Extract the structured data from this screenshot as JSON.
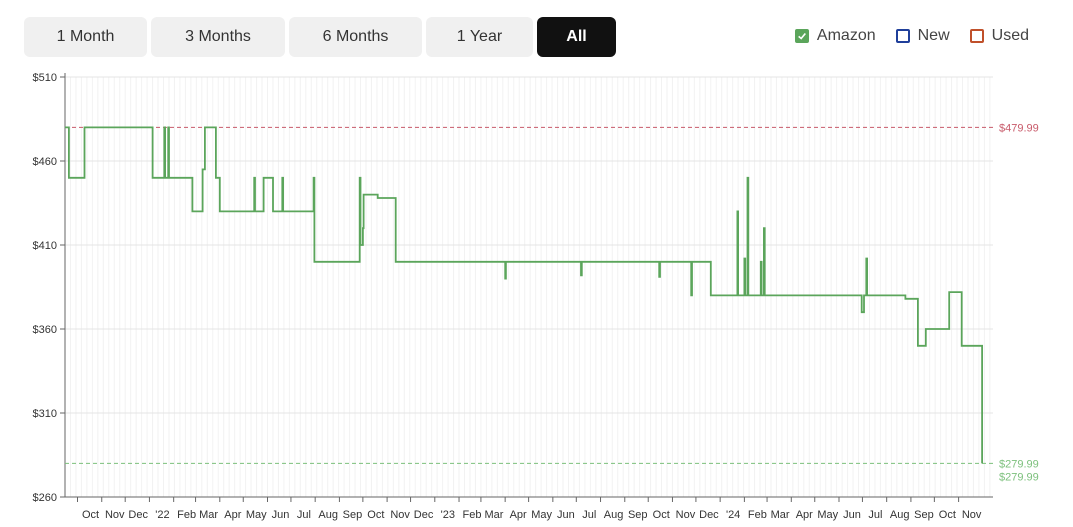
{
  "ranges": [
    {
      "label": "1 Month",
      "active": false
    },
    {
      "label": "3 Months",
      "active": false
    },
    {
      "label": "6 Months",
      "active": false
    },
    {
      "label": "1 Year",
      "active": false
    },
    {
      "label": "All",
      "active": true
    }
  ],
  "legend": [
    {
      "label": "Amazon",
      "color": "#5ba55b",
      "checked": true
    },
    {
      "label": "New",
      "color": "#1f3f9a",
      "checked": false
    },
    {
      "label": "Used",
      "color": "#c0502a",
      "checked": false
    }
  ],
  "chart_data": {
    "type": "line",
    "x_axis": "dates",
    "ylim": [
      260,
      510
    ],
    "y_ticks": [
      {
        "value": 510,
        "label": "$510"
      },
      {
        "value": 460,
        "label": "$460"
      },
      {
        "value": 410,
        "label": "$410"
      },
      {
        "value": 360,
        "label": "$360"
      },
      {
        "value": 310,
        "label": "$310"
      },
      {
        "value": 260,
        "label": "$260"
      }
    ],
    "xlim": [
      "2021-09-15",
      "2024-12-15"
    ],
    "x_ticks": [
      {
        "date": "2021-10-01",
        "label": "Oct"
      },
      {
        "date": "2021-11-01",
        "label": "Nov"
      },
      {
        "date": "2021-12-01",
        "label": "Dec"
      },
      {
        "date": "2022-01-01",
        "label": "'22"
      },
      {
        "date": "2022-02-01",
        "label": "Feb"
      },
      {
        "date": "2022-03-01",
        "label": "Mar"
      },
      {
        "date": "2022-04-01",
        "label": "Apr"
      },
      {
        "date": "2022-05-01",
        "label": "May"
      },
      {
        "date": "2022-06-01",
        "label": "Jun"
      },
      {
        "date": "2022-07-01",
        "label": "Jul"
      },
      {
        "date": "2022-08-01",
        "label": "Aug"
      },
      {
        "date": "2022-09-01",
        "label": "Sep"
      },
      {
        "date": "2022-10-01",
        "label": "Oct"
      },
      {
        "date": "2022-11-01",
        "label": "Nov"
      },
      {
        "date": "2022-12-01",
        "label": "Dec"
      },
      {
        "date": "2023-01-01",
        "label": "'23"
      },
      {
        "date": "2023-02-01",
        "label": "Feb"
      },
      {
        "date": "2023-03-01",
        "label": "Mar"
      },
      {
        "date": "2023-04-01",
        "label": "Apr"
      },
      {
        "date": "2023-05-01",
        "label": "May"
      },
      {
        "date": "2023-06-01",
        "label": "Jun"
      },
      {
        "date": "2023-07-01",
        "label": "Jul"
      },
      {
        "date": "2023-08-01",
        "label": "Aug"
      },
      {
        "date": "2023-09-01",
        "label": "Sep"
      },
      {
        "date": "2023-10-01",
        "label": "Oct"
      },
      {
        "date": "2023-11-01",
        "label": "Nov"
      },
      {
        "date": "2023-12-01",
        "label": "Dec"
      },
      {
        "date": "2024-01-01",
        "label": "'24"
      },
      {
        "date": "2024-02-01",
        "label": "Feb"
      },
      {
        "date": "2024-03-01",
        "label": "Mar"
      },
      {
        "date": "2024-04-01",
        "label": "Apr"
      },
      {
        "date": "2024-05-01",
        "label": "May"
      },
      {
        "date": "2024-06-01",
        "label": "Jun"
      },
      {
        "date": "2024-07-01",
        "label": "Jul"
      },
      {
        "date": "2024-08-01",
        "label": "Aug"
      },
      {
        "date": "2024-09-01",
        "label": "Sep"
      },
      {
        "date": "2024-10-01",
        "label": "Oct"
      },
      {
        "date": "2024-11-01",
        "label": "Nov"
      }
    ],
    "reference_lines": [
      {
        "value": 479.99,
        "label": "$479.99",
        "color": "#c85a6a"
      },
      {
        "value": 279.99,
        "label": "$279.99",
        "color": "#7cc07c"
      }
    ],
    "current_price_label": "$279.99",
    "series": [
      {
        "name": "Amazon",
        "color": "#5ba55b",
        "step": true,
        "points": [
          [
            "2021-09-15",
            479.99
          ],
          [
            "2021-09-20",
            450
          ],
          [
            "2021-10-10",
            479.99
          ],
          [
            "2021-11-25",
            479.99
          ],
          [
            "2021-12-20",
            479.99
          ],
          [
            "2022-01-05",
            450
          ],
          [
            "2022-01-20",
            479.99
          ],
          [
            "2022-01-21",
            450
          ],
          [
            "2022-01-25",
            479.99
          ],
          [
            "2022-01-26",
            450
          ],
          [
            "2022-02-25",
            429.99
          ],
          [
            "2022-03-10",
            454.99
          ],
          [
            "2022-03-13",
            479.99
          ],
          [
            "2022-03-27",
            450
          ],
          [
            "2022-04-01",
            429.99
          ],
          [
            "2022-05-15",
            449.99
          ],
          [
            "2022-05-16",
            429.99
          ],
          [
            "2022-05-27",
            449.99
          ],
          [
            "2022-06-08",
            429.99
          ],
          [
            "2022-06-20",
            449.99
          ],
          [
            "2022-06-21",
            429.99
          ],
          [
            "2022-07-30",
            449.99
          ],
          [
            "2022-07-31",
            399.99
          ],
          [
            "2022-09-27",
            449.99
          ],
          [
            "2022-09-28",
            409.99
          ],
          [
            "2022-10-01",
            419.99
          ],
          [
            "2022-10-02",
            439.99
          ],
          [
            "2022-10-20",
            437.99
          ],
          [
            "2022-11-12",
            399.99
          ],
          [
            "2023-03-01",
            399.99
          ],
          [
            "2023-04-01",
            389.99
          ],
          [
            "2023-04-02",
            399.99
          ],
          [
            "2023-07-07",
            391.99
          ],
          [
            "2023-07-08",
            399.99
          ],
          [
            "2023-10-15",
            390.99
          ],
          [
            "2023-10-16",
            399.99
          ],
          [
            "2023-11-25",
            379.99
          ],
          [
            "2023-11-26",
            399.99
          ],
          [
            "2023-12-20",
            379.99
          ],
          [
            "2024-01-23",
            429.99
          ],
          [
            "2024-01-24",
            379.99
          ],
          [
            "2024-02-01",
            401.99
          ],
          [
            "2024-02-02",
            379.99
          ],
          [
            "2024-02-05",
            449.99
          ],
          [
            "2024-02-06",
            379.99
          ],
          [
            "2024-02-22",
            399.99
          ],
          [
            "2024-02-23",
            379.99
          ],
          [
            "2024-02-26",
            419.99
          ],
          [
            "2024-02-27",
            379.99
          ],
          [
            "2024-06-30",
            369.99
          ],
          [
            "2024-07-03",
            379.99
          ],
          [
            "2024-07-06",
            401.99
          ],
          [
            "2024-07-07",
            379.99
          ],
          [
            "2024-08-25",
            377.99
          ],
          [
            "2024-09-10",
            349.99
          ],
          [
            "2024-09-20",
            359.99
          ],
          [
            "2024-10-20",
            381.99
          ],
          [
            "2024-11-05",
            349.99
          ],
          [
            "2024-12-01",
            349.99
          ],
          [
            "2024-12-01",
            279.99
          ]
        ]
      }
    ]
  }
}
